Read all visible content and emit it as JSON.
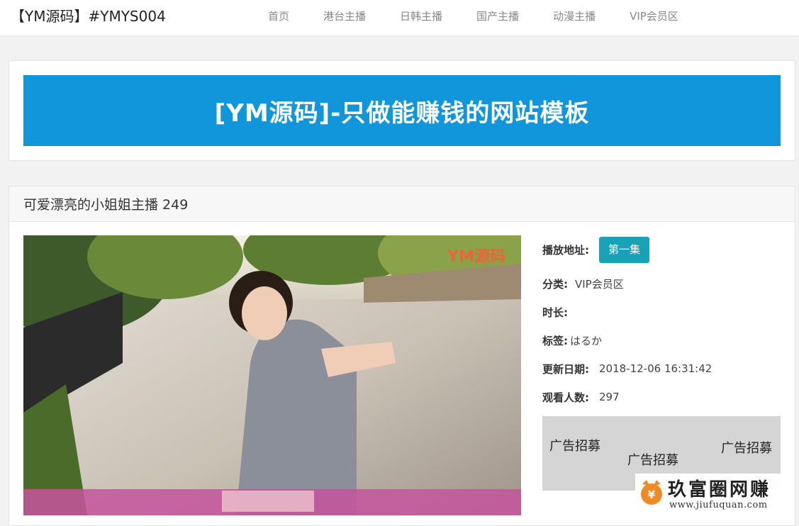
{
  "site": {
    "title": "【YM源码】#YMYS004"
  },
  "nav": [
    "首页",
    "港台主播",
    "日韩主播",
    "国产主播",
    "动漫主播",
    "VIP会员区"
  ],
  "banner": {
    "text": "[YM源码]-只做能赚钱的网站模板",
    "color": "#1296db"
  },
  "video": {
    "title": "可爱漂亮的小姐姐主播 249",
    "poster_watermark": "YM源码",
    "play_label": "播放地址:",
    "episode_button": "第一集",
    "category_label": "分类:",
    "category_value": "VIP会员区",
    "duration_label": "时长:",
    "tags_label": "标签:",
    "tags_value": "はるか",
    "updated_label": "更新日期:",
    "updated_value": "2018-12-06 16:31:42",
    "views_label": "观看人数:",
    "views_value": "297"
  },
  "ad": {
    "labels": [
      "广告招募",
      "广告招募",
      "广告招募"
    ]
  },
  "watermark": {
    "title": "玖富圈网赚",
    "url": "www.jiufuquan.com"
  },
  "colors": {
    "accent_button": "#17a2b8",
    "ad_bg": "#d5d5d5"
  }
}
